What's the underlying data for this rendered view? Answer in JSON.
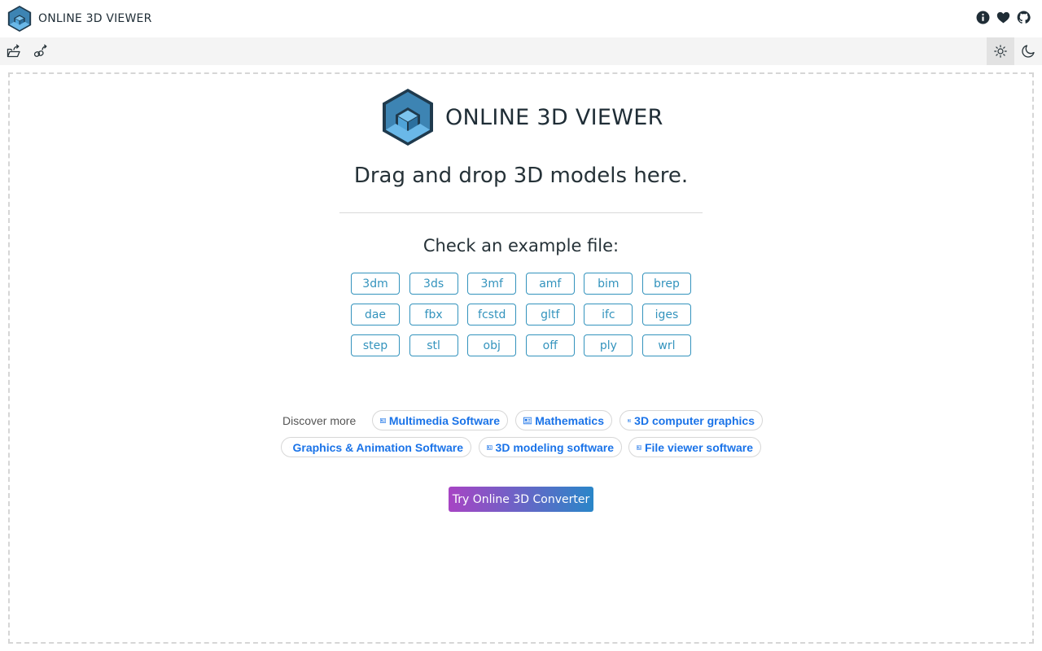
{
  "app": {
    "title": "ONLINE 3D VIEWER"
  },
  "header": {
    "icons": [
      "info-icon",
      "heart-icon",
      "github-icon"
    ]
  },
  "toolbar": {
    "left_icons": [
      "open-file-icon",
      "open-url-icon"
    ],
    "right_icons": [
      "sun-icon",
      "moon-icon"
    ],
    "active_theme": "light"
  },
  "intro": {
    "title": "ONLINE 3D VIEWER",
    "drop_text": "Drag and drop 3D models here.",
    "example_heading": "Check an example file:",
    "examples": [
      "3dm",
      "3ds",
      "3mf",
      "amf",
      "bim",
      "brep",
      "dae",
      "fbx",
      "fcstd",
      "gltf",
      "ifc",
      "iges",
      "step",
      "stl",
      "obj",
      "off",
      "ply",
      "wrl"
    ]
  },
  "discover": {
    "label": "Discover more",
    "chips": [
      "Multimedia Software",
      "Mathematics",
      "3D computer graphics",
      "Graphics & Animation Software",
      "3D modeling software",
      "File viewer software"
    ]
  },
  "converter": {
    "label": "Try Online 3D Converter"
  },
  "colors": {
    "accent": "#3393bd",
    "chip_text": "#1a73e8",
    "gradient_start": "#a744c4",
    "gradient_end": "#2a86c8",
    "toolbar_bg": "#f4f4f4"
  }
}
